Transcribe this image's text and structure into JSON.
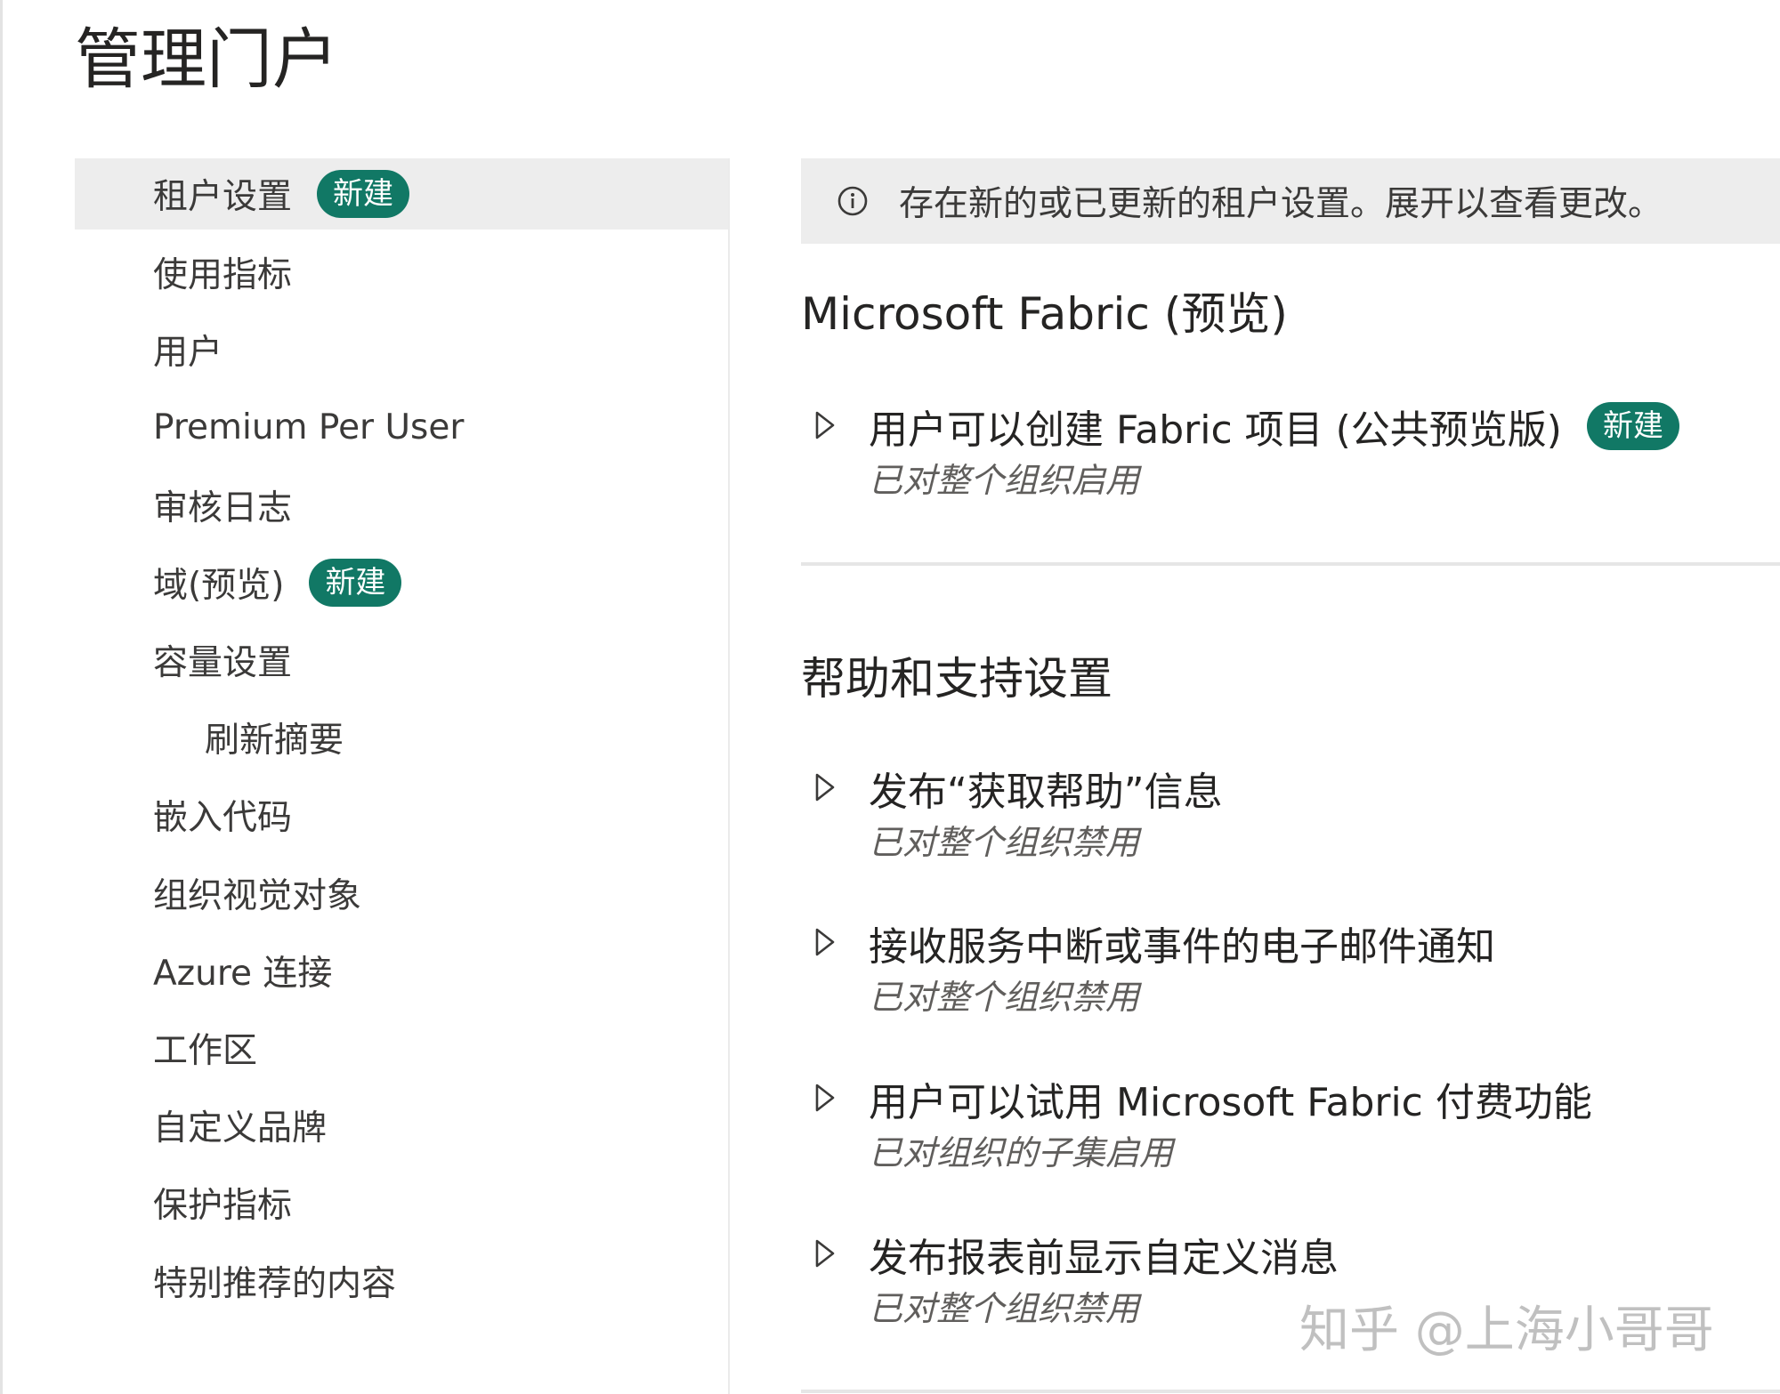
{
  "page": {
    "title": "管理门户"
  },
  "nav": {
    "items": [
      {
        "label": "租户设置",
        "badge": "新建"
      },
      {
        "label": "使用指标"
      },
      {
        "label": "用户"
      },
      {
        "label": "Premium Per User"
      },
      {
        "label": "审核日志"
      },
      {
        "label": "域(预览)",
        "badge": "新建"
      },
      {
        "label": "容量设置"
      },
      {
        "label": "刷新摘要"
      },
      {
        "label": "嵌入代码"
      },
      {
        "label": "组织视觉对象"
      },
      {
        "label": "Azure 连接"
      },
      {
        "label": "工作区"
      },
      {
        "label": "自定义品牌"
      },
      {
        "label": "保护指标"
      },
      {
        "label": "特别推荐的内容"
      }
    ],
    "active_index": 0
  },
  "banner": {
    "icon": "info-icon",
    "text": "存在新的或已更新的租户设置。展开以查看更改。"
  },
  "sections": [
    {
      "title": "Microsoft Fabric (预览)",
      "settings": [
        {
          "title": "用户可以创建 Fabric 项目 (公共预览版)",
          "badge": "新建",
          "status": "已对整个组织启用"
        }
      ]
    },
    {
      "title": "帮助和支持设置",
      "settings": [
        {
          "title": "发布“获取帮助”信息",
          "status": "已对整个组织禁用"
        },
        {
          "title": "接收服务中断或事件的电子邮件通知",
          "status": "已对整个组织禁用"
        },
        {
          "title": "用户可以试用 Microsoft Fabric 付费功能",
          "status": "已对组织的子集启用"
        },
        {
          "title": "发布报表前显示自定义消息",
          "status": "已对整个组织禁用"
        }
      ]
    }
  ],
  "watermark": "知乎 @上海小哥哥",
  "colors": {
    "badge": "#117865",
    "active_bg": "#ededed",
    "banner_bg": "#ededed"
  }
}
